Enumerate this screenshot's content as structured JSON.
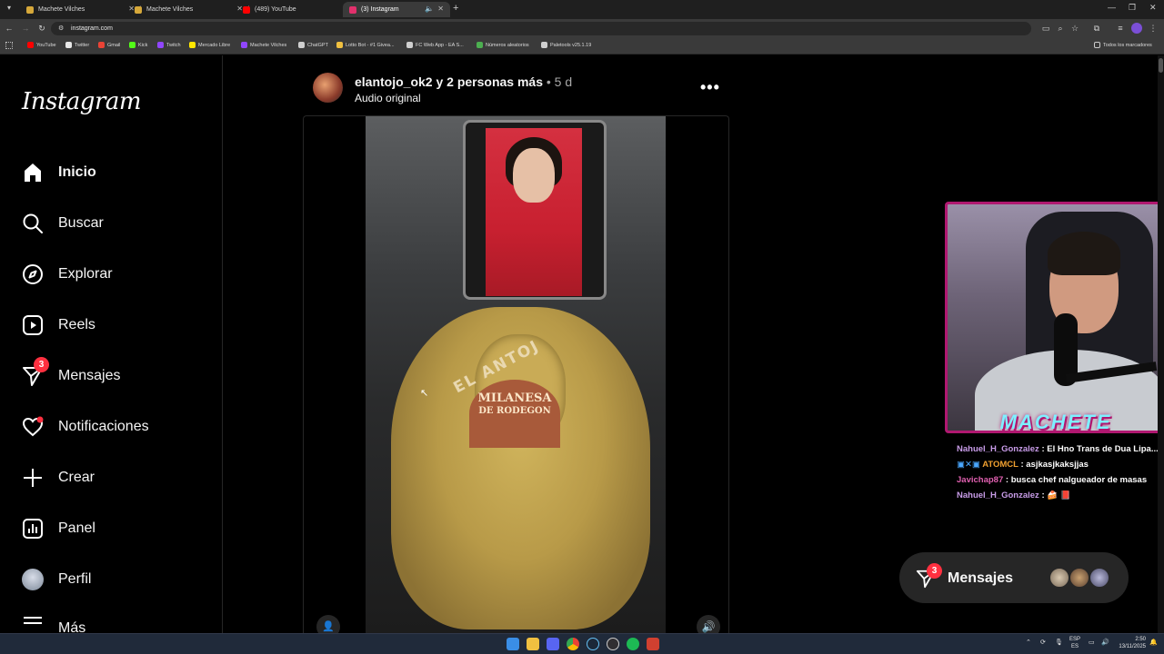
{
  "browser": {
    "tabs": [
      {
        "title": "Machete Vilches",
        "color": "#d6a83a"
      },
      {
        "title": "Machete Vilches",
        "color": "#d6a83a"
      },
      {
        "title": "(489) YouTube",
        "color": "#ff0000"
      },
      {
        "title": "(3) Instagram",
        "color": "#e1306c"
      }
    ],
    "url": "instagram.com",
    "bookmarks": [
      {
        "label": "YouTube",
        "color": "#ff0000"
      },
      {
        "label": "Twitter",
        "color": "#e7e7e7"
      },
      {
        "label": "Gmail",
        "color": "#ea4335"
      },
      {
        "label": "Kick",
        "color": "#53fc18"
      },
      {
        "label": "Twitch",
        "color": "#9146ff"
      },
      {
        "label": "Mercado Libre",
        "color": "#ffe600"
      },
      {
        "label": "Machete Vilches",
        "color": "#9146ff"
      },
      {
        "label": "ChatGPT",
        "color": "#cfcfcf"
      },
      {
        "label": "Lotto Bot - #1 Givea...",
        "color": "#f0c040"
      },
      {
        "label": "FC Web App - EA S...",
        "color": "#cfcfcf"
      },
      {
        "label": "Números aleatorios",
        "color": "#4caf50"
      },
      {
        "label": "Paletools v25.1.19",
        "color": "#cfcfcf"
      }
    ],
    "all_bookmarks": "Todos los marcadores"
  },
  "instagram": {
    "logo": "Instagram",
    "nav": [
      {
        "label": "Inicio",
        "icon": "home-icon"
      },
      {
        "label": "Buscar",
        "icon": "search-icon"
      },
      {
        "label": "Explorar",
        "icon": "compass-icon"
      },
      {
        "label": "Reels",
        "icon": "reels-icon"
      },
      {
        "label": "Mensajes",
        "icon": "messenger-icon",
        "badge": "3"
      },
      {
        "label": "Notificaciones",
        "icon": "heart-icon"
      },
      {
        "label": "Crear",
        "icon": "plus-icon"
      },
      {
        "label": "Panel",
        "icon": "chart-icon"
      },
      {
        "label": "Perfil",
        "icon": "avatar-icon"
      },
      {
        "label": "Más",
        "icon": "menu-icon"
      }
    ],
    "post": {
      "user": "elantojo_ok2 y 2 personas más",
      "time": "• 5 d",
      "audio": "Audio original",
      "overlay_text": "EL ANTOJ",
      "logo_line1": "MILANESA",
      "logo_line2": "DE RODEGON"
    },
    "messages_pill": {
      "label": "Mensajes",
      "badge": "3"
    }
  },
  "stream": {
    "webcam_label": "MACHETE",
    "chat": [
      {
        "user": "Nahuel_H_Gonzalez",
        "user_color": "#c89ce8",
        "text": "El Hno Trans de Dua Lipa..."
      },
      {
        "user": "ATOMCL",
        "user_color": "#f0a030",
        "text": "asjkasjkaksjjas"
      },
      {
        "user": "Javichap87",
        "user_color": "#e060b0",
        "text": "busca chef nalgueador de masas"
      },
      {
        "user": "Nahuel_H_Gonzalez",
        "user_color": "#c89ce8",
        "text": "🍰 📕"
      }
    ]
  },
  "taskbar": {
    "lang_top": "ESP",
    "lang_bottom": "ES",
    "time": "2:50",
    "date": "13/11/2025"
  }
}
